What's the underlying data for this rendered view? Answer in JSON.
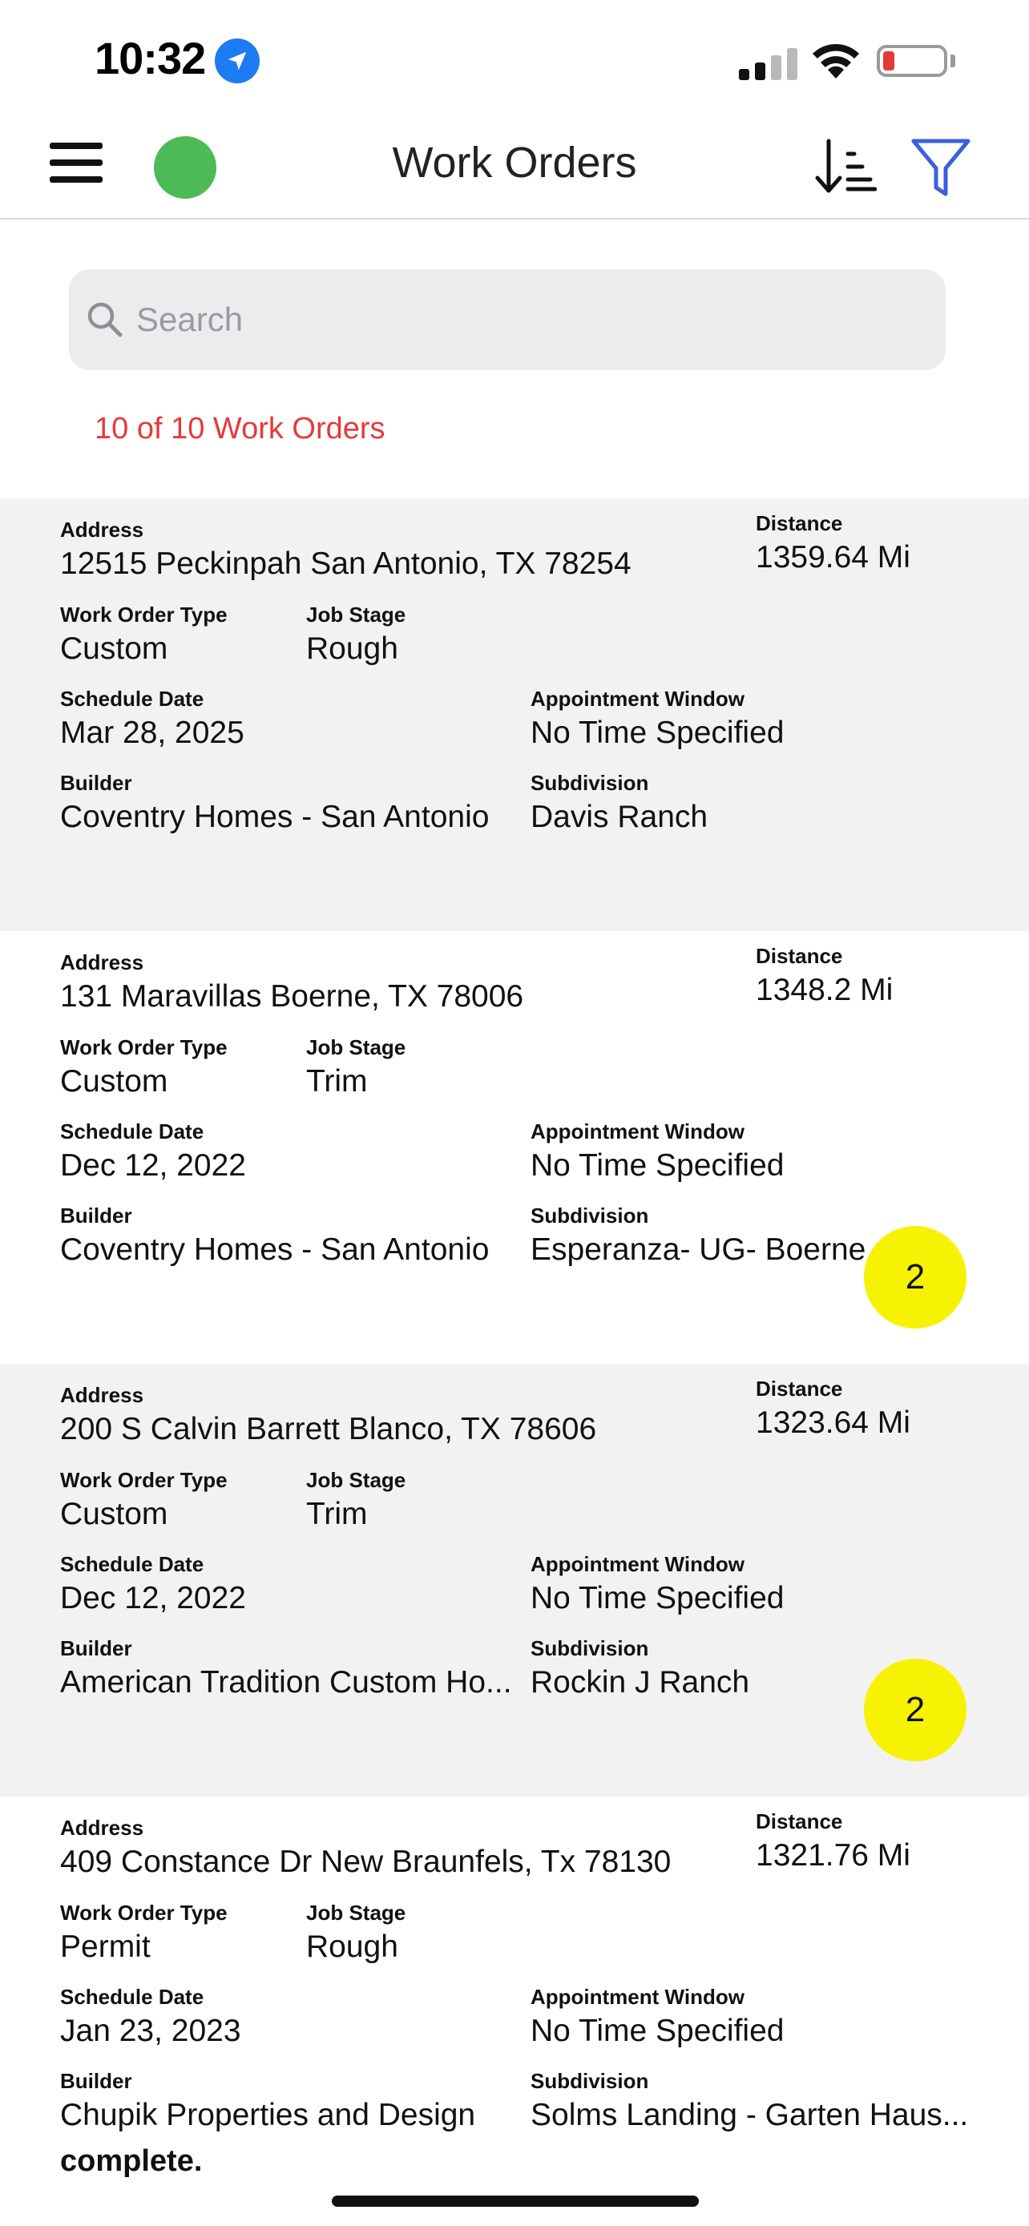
{
  "status_bar": {
    "time": "10:32",
    "icons": [
      "location-arrow-icon",
      "cellular-signal-icon",
      "wifi-icon",
      "battery-low-icon"
    ]
  },
  "navbar": {
    "title": "Work Orders",
    "icons": [
      "hamburger-menu-icon",
      "online-status-dot",
      "sort-icon",
      "filter-icon"
    ],
    "status_color": "#4cbb56",
    "accent_color": "#3a5fe0"
  },
  "search": {
    "placeholder": "Search",
    "value": ""
  },
  "count_text": "10 of 10 Work Orders",
  "labels": {
    "address": "Address",
    "distance": "Distance",
    "work_order_type": "Work Order Type",
    "job_stage": "Job Stage",
    "schedule_date": "Schedule Date",
    "appointment_window": "Appointment Window",
    "builder": "Builder",
    "subdivision": "Subdivision"
  },
  "orders": [
    {
      "address": "12515 Peckinpah  San Antonio, TX  78254",
      "distance": "1359.64 Mi",
      "work_order_type": "Custom",
      "job_stage": "Rough",
      "schedule_date": "Mar 28, 2025",
      "appointment_window": "No Time Specified",
      "builder": "Coventry Homes - San Antonio",
      "subdivision": "Davis Ranch"
    },
    {
      "address": "131 Maravillas  Boerne, TX  78006",
      "distance": "1348.2 Mi",
      "work_order_type": "Custom",
      "job_stage": "Trim",
      "schedule_date": "Dec 12, 2022",
      "appointment_window": "No Time Specified",
      "builder": "Coventry Homes - San Antonio",
      "subdivision": "Esperanza- UG- Boerne r",
      "badge": "2"
    },
    {
      "address": "200 S Calvin Barrett Blanco, TX 78606",
      "distance": "1323.64 Mi",
      "work_order_type": "Custom",
      "job_stage": "Trim",
      "schedule_date": "Dec 12, 2022",
      "appointment_window": "No Time Specified",
      "builder": "American Tradition Custom Ho...",
      "subdivision": "Rockin J Ranch",
      "badge": "2"
    },
    {
      "address": "409 Constance Dr New Braunfels, Tx 78130",
      "distance": "1321.76 Mi",
      "work_order_type": "Permit",
      "job_stage": "Rough",
      "schedule_date": "Jan 23, 2023",
      "appointment_window": "No Time Specified",
      "builder": "Chupik Properties and Design",
      "subdivision": "Solms Landing - Garten Haus..."
    }
  ],
  "footer_text": "complete.",
  "badge_color": "#f7f203"
}
